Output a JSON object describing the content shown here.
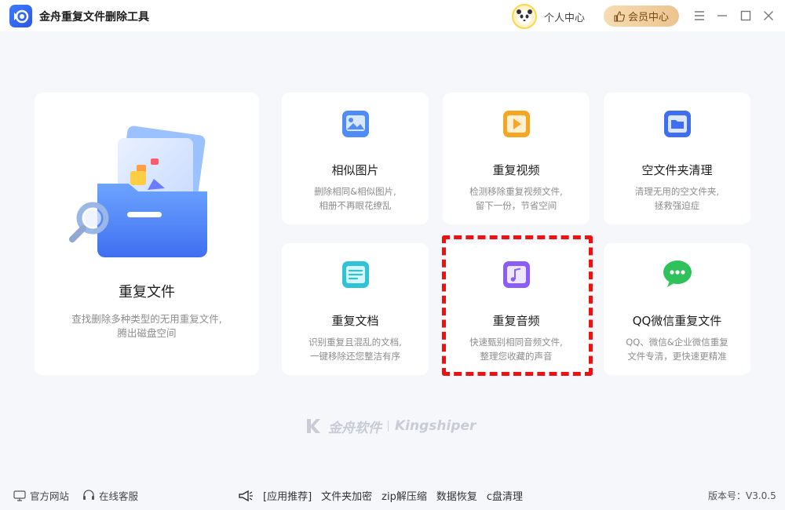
{
  "app": {
    "title": "金舟重复文件删除工具",
    "user_center": "个人中心",
    "vip_center": "会员中心"
  },
  "main_card": {
    "title": "重复文件",
    "desc_line1": "查找删除多种类型的无用重复文件,",
    "desc_line2": "腾出磁盘空间"
  },
  "cards": [
    {
      "title": "相似图片",
      "desc1": "删除相同&相似图片,",
      "desc2": "相册不再眼花缭乱",
      "icon": "image-icon"
    },
    {
      "title": "重复视频",
      "desc1": "检测移除重复视频文件,",
      "desc2": "留下一份，节省空间",
      "icon": "video-icon"
    },
    {
      "title": "空文件夹清理",
      "desc1": "清理无用的空文件夹,",
      "desc2": "拯救强迫症",
      "icon": "folder-icon"
    },
    {
      "title": "重复文档",
      "desc1": "识别重复且混乱的文档,",
      "desc2": "一键移除还您整洁有序",
      "icon": "document-icon"
    },
    {
      "title": "重复音频",
      "desc1": "快速甄别相同音频文件,",
      "desc2": "整理您收藏的声音",
      "icon": "music-icon"
    },
    {
      "title": "QQ微信重复文件",
      "desc1": "QQ、微信&企业微信重复",
      "desc2": "文件专清，更快速更精准",
      "icon": "wechat-icon"
    }
  ],
  "watermark": {
    "cn": "金舟软件",
    "en": "Kingshiper"
  },
  "footer": {
    "website": "官方网站",
    "support": "在线客服",
    "promo_label": "[应用推荐]",
    "promo_items": [
      "文件夹加密",
      "zip解压缩",
      "数据恢复",
      "c盘清理"
    ],
    "version": "版本号：V3.0.5"
  }
}
